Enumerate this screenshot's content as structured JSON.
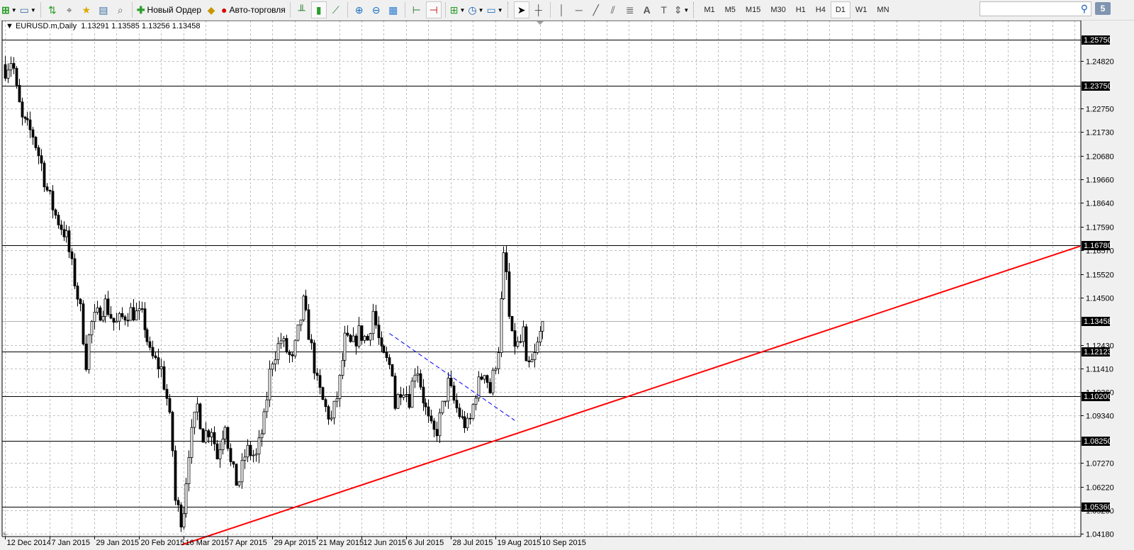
{
  "toolbar": {
    "new_order_label": "Новый Ордер",
    "auto_trading_label": "Авто-торговля",
    "timeframes": [
      "M1",
      "M5",
      "M15",
      "M30",
      "H1",
      "H4",
      "D1",
      "W1",
      "MN"
    ],
    "active_timeframe": "D1",
    "search_placeholder": "",
    "messages_count": "5"
  },
  "chart_header": {
    "symbol": "EURUSD.m,Daily",
    "ohlc": "1.13291 1.13585 1.13256 1.13458"
  },
  "colors": {
    "trendline": "#ff0000",
    "channel": "#0000ff",
    "grid": "#c0c0c0",
    "level": "#000000"
  },
  "chart_data": {
    "type": "candlestick",
    "symbol": "EURUSD.m",
    "timeframe": "Daily",
    "ylim": [
      1.0406,
      1.2659
    ],
    "bar_count": 194,
    "x_tick_labels": [
      {
        "bar": 0,
        "label": "12 Dec 2014"
      },
      {
        "bar": 16,
        "label": "7 Jan 2015"
      },
      {
        "bar": 32,
        "label": "29 Jan 2015"
      },
      {
        "bar": 48,
        "label": "20 Feb 2015"
      },
      {
        "bar": 64,
        "label": "16 Mar 2015"
      },
      {
        "bar": 80,
        "label": "7 Apr 2015"
      },
      {
        "bar": 96,
        "label": "29 Apr 2015"
      },
      {
        "bar": 112,
        "label": "21 May 2015"
      },
      {
        "bar": 128,
        "label": "12 Jun 2015"
      },
      {
        "bar": 144,
        "label": "6 Jul 2015"
      },
      {
        "bar": 160,
        "label": "28 Jul 2015"
      },
      {
        "bar": 176,
        "label": "19 Aug 2015"
      },
      {
        "bar": 192,
        "label": "10 Sep 2015"
      }
    ],
    "y_ticks": [
      "1.24820",
      "1.22750",
      "1.21730",
      "1.20680",
      "1.19660",
      "1.18640",
      "1.17590",
      "1.16570",
      "1.15520",
      "1.14500",
      "1.12430",
      "1.11410",
      "1.10360",
      "1.09340",
      "1.07270",
      "1.06220",
      "1.05200",
      "1.04180"
    ],
    "levels": [
      "1.25750",
      "1.23750",
      "1.16780",
      "1.12123",
      "1.10200",
      "1.08250",
      "1.05360"
    ],
    "current_price": "1.13458",
    "close_path": [
      [
        0,
        1.2447
      ],
      [
        2.5,
        1.2495
      ],
      [
        4,
        1.2351
      ],
      [
        6,
        1.2223
      ],
      [
        10,
        1.216
      ],
      [
        13,
        1.2032
      ],
      [
        14.5,
        1.1936
      ],
      [
        18,
        1.1808
      ],
      [
        22,
        1.1712
      ],
      [
        24,
        1.1584
      ],
      [
        27,
        1.1392
      ],
      [
        29,
        1.1169
      ],
      [
        30.5,
        1.1329
      ],
      [
        36,
        1.1424
      ],
      [
        39.5,
        1.1329
      ],
      [
        44.5,
        1.1392
      ],
      [
        49.5,
        1.1361
      ],
      [
        52,
        1.1201
      ],
      [
        56,
        1.1137
      ],
      [
        58.5,
        1.0977
      ],
      [
        60,
        1.0785
      ],
      [
        61,
        1.0562
      ],
      [
        63.5,
        1.0466
      ],
      [
        66,
        1.0785
      ],
      [
        69,
        1.0977
      ],
      [
        71,
        1.0849
      ],
      [
        74,
        1.0881
      ],
      [
        76,
        1.0753
      ],
      [
        79,
        1.0913
      ],
      [
        81,
        1.0721
      ],
      [
        83.5,
        1.0625
      ],
      [
        86.5,
        1.0785
      ],
      [
        90,
        1.0753
      ],
      [
        93,
        1.0913
      ],
      [
        95.5,
        1.1169
      ],
      [
        99,
        1.1265
      ],
      [
        103,
        1.1169
      ],
      [
        107,
        1.1424
      ],
      [
        109.5,
        1.1265
      ],
      [
        112,
        1.1073
      ],
      [
        114.5,
        1.0977
      ],
      [
        117,
        1.0913
      ],
      [
        119.5,
        1.1041
      ],
      [
        122,
        1.1265
      ],
      [
        124.5,
        1.1233
      ],
      [
        127,
        1.1297
      ],
      [
        130,
        1.1265
      ],
      [
        132,
        1.1392
      ],
      [
        135,
        1.1201
      ],
      [
        139,
        1.1137
      ],
      [
        140,
        1.0977
      ],
      [
        142.5,
        1.1073
      ],
      [
        145,
        1.1009
      ],
      [
        147.5,
        1.1169
      ],
      [
        150,
        1.1009
      ],
      [
        152.5,
        1.0881
      ],
      [
        154.5,
        1.0849
      ],
      [
        156.5,
        1.0945
      ],
      [
        159,
        1.1073
      ],
      [
        161.5,
        1.0977
      ],
      [
        164,
        1.0913
      ],
      [
        166.5,
        1.0881
      ],
      [
        169,
        1.1041
      ],
      [
        172,
        1.1137
      ],
      [
        174,
        1.1041
      ],
      [
        177,
        1.1233
      ],
      [
        178,
        1.1424
      ],
      [
        179,
        1.1616
      ],
      [
        180,
        1.1552
      ],
      [
        181,
        1.1361
      ],
      [
        182,
        1.1265
      ],
      [
        184.5,
        1.1233
      ],
      [
        186,
        1.1297
      ],
      [
        187,
        1.1137
      ],
      [
        189.5,
        1.1169
      ],
      [
        191.5,
        1.1265
      ],
      [
        193,
        1.13458
      ]
    ],
    "trendlines": [
      {
        "name": "support-trendline",
        "color": "#ff0000",
        "style": "solid",
        "points": [
          [
            63.5,
            1.037
          ],
          [
            386,
            1.1674
          ]
        ]
      },
      {
        "name": "channel-line",
        "color": "#0000ff",
        "style": "dashed",
        "points": [
          [
            138,
            1.1293
          ],
          [
            183,
            1.0913
          ]
        ]
      }
    ]
  }
}
